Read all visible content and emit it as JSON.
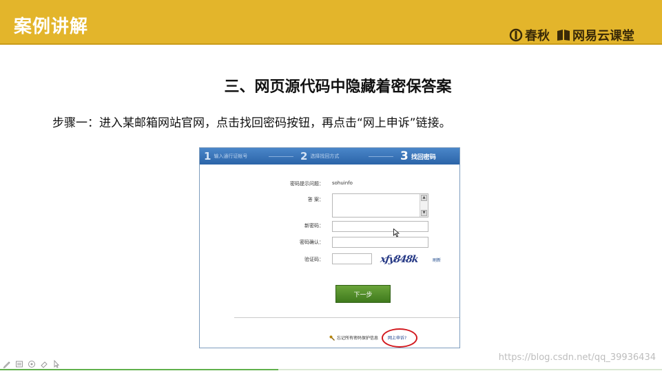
{
  "header": {
    "title": "案例讲解",
    "brand_left": "春秋",
    "brand_right": "网易云课堂",
    "color": "#e3b52b"
  },
  "slide": {
    "title": "三、网页源代码中隐藏着密保答案",
    "step_text": "步骤一：进入某邮箱网站官网，点击找回密码按钮，再点击“网上申诉”链接。"
  },
  "screenshot": {
    "steps": [
      {
        "num": "1",
        "label": "输入通行证帐号"
      },
      {
        "num": "2",
        "label": "选择找回方式"
      },
      {
        "num": "3",
        "label": "找回密码"
      }
    ],
    "form": {
      "hint_label": "密码提示问题：",
      "hint_value": "sohuinfo",
      "answer_label": "答  案：",
      "new_password_label": "新密码：",
      "confirm_label": "密码确认：",
      "captcha_label": "验证码：",
      "captcha_text": "xfy848k",
      "refresh_label": "刷新",
      "next_button": "下一步",
      "forgot_text": "忘记所有密码保护信息",
      "appeal_link": "网上申诉?"
    }
  },
  "watermark": "https://blog.csdn.net/qq_39936434",
  "playback_progress": 0.42
}
